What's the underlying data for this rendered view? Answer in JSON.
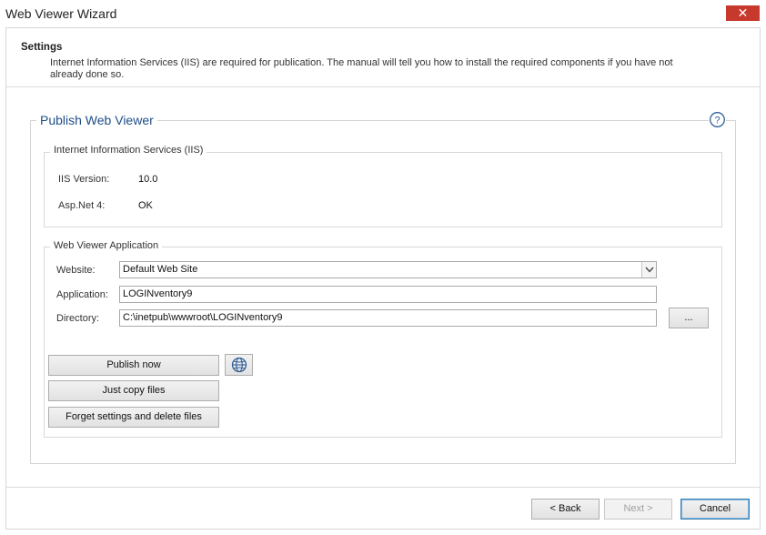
{
  "window": {
    "title": "Web Viewer Wizard",
    "close_glyph": "✕"
  },
  "header": {
    "title": "Settings",
    "description": "Internet Information Services (IIS) are required for publication. The manual will tell you how to install the required components if you have not already done so."
  },
  "publish_group": {
    "title": "Publish Web Viewer",
    "help_icon": "question-circle-icon"
  },
  "iis_group": {
    "title": "Internet Information Services (IIS)",
    "iis_version_label": "IIS Version:",
    "iis_version_value": "10.0",
    "aspnet_label": "Asp.Net 4:",
    "aspnet_value": "OK"
  },
  "app_group": {
    "title": "Web Viewer Application",
    "website_label": "Website:",
    "website_value": "Default Web Site",
    "application_label": "Application:",
    "application_value": "LOGINventory9",
    "directory_label": "Directory:",
    "directory_value": "C:\\inetpub\\wwwroot\\LOGINventory9",
    "browse_label": "...",
    "publish_now_label": "Publish now",
    "open_browser_icon": "globe-icon",
    "copy_files_label": "Just copy files",
    "forget_label": "Forget settings and delete files"
  },
  "footer": {
    "back_label": "< Back",
    "next_label": "Next >",
    "cancel_label": "Cancel"
  },
  "colors": {
    "close_button": "#c7392d",
    "group_title": "#1f4e88",
    "default_button_border": "#3c7fb1"
  }
}
